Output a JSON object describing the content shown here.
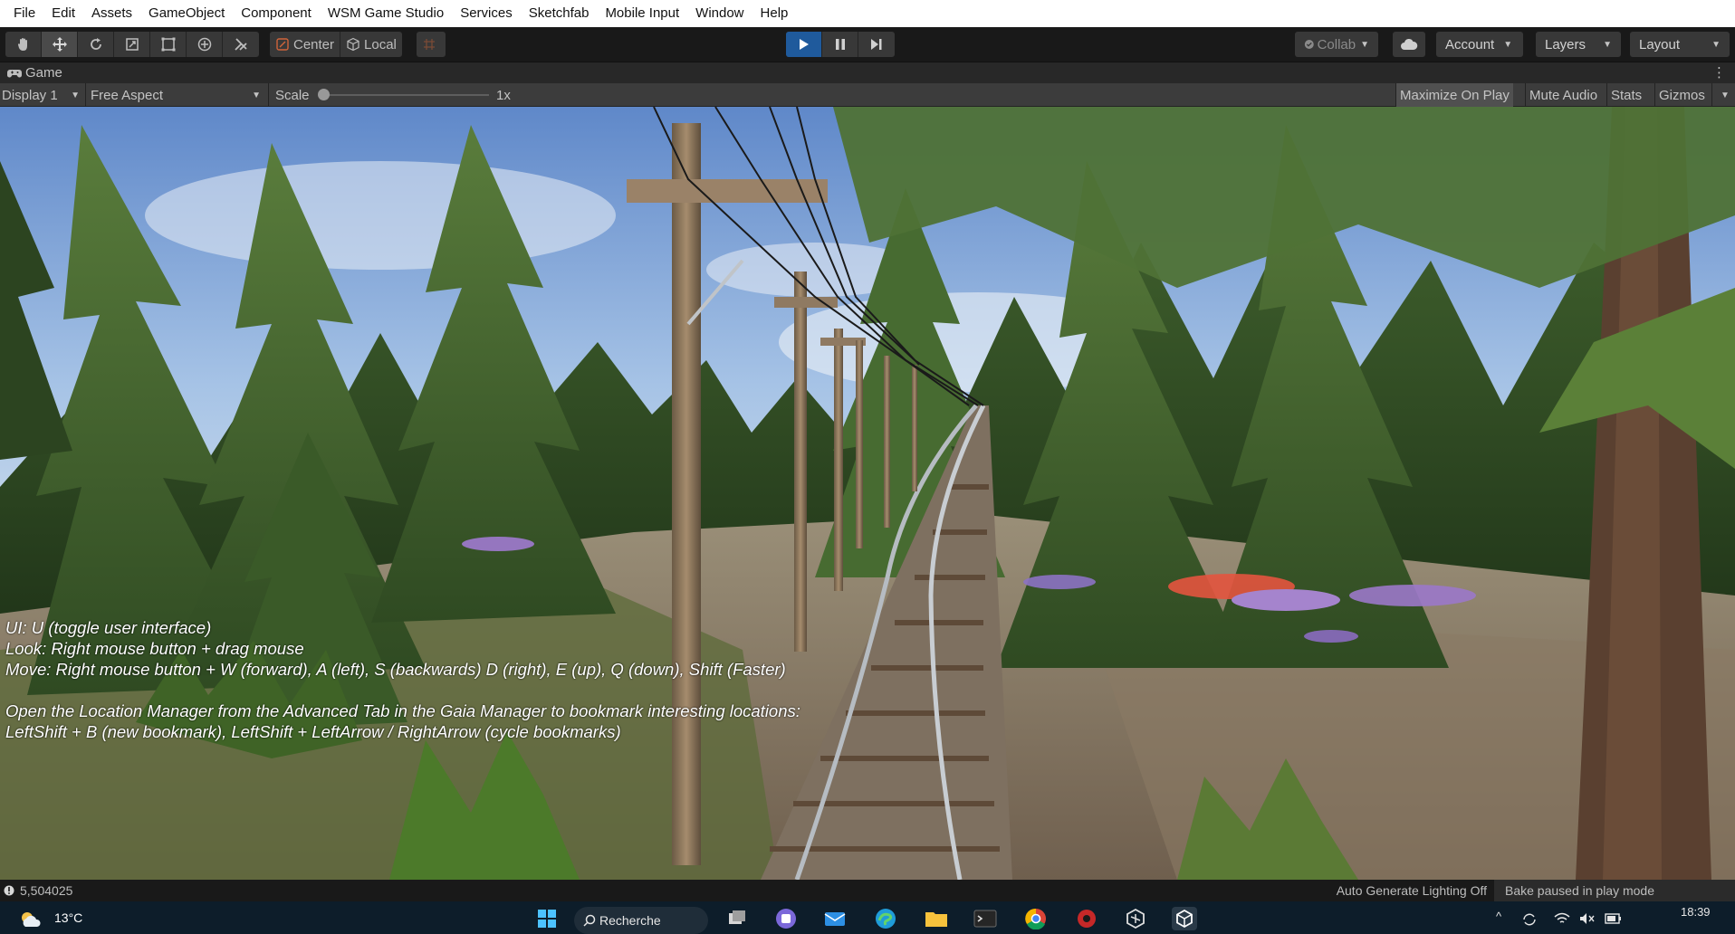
{
  "menu": [
    "File",
    "Edit",
    "Assets",
    "GameObject",
    "Component",
    "WSM Game Studio",
    "Services",
    "Sketchfab",
    "Mobile Input",
    "Window",
    "Help"
  ],
  "toolbar": {
    "tools": [
      "hand-tool",
      "move-tool",
      "rotate-tool",
      "scale-tool",
      "rect-tool",
      "transform-tool",
      "custom-tool"
    ],
    "pivot_label": "Center",
    "space_label": "Local",
    "collab_label": "Collab",
    "account_label": "Account",
    "layers_label": "Layers",
    "layout_label": "Layout"
  },
  "game_tab": {
    "label": "Game"
  },
  "game_toolbar": {
    "display": "Display 1",
    "aspect": "Free Aspect",
    "scale_label": "Scale",
    "scale_value": "1x",
    "maximize": "Maximize On Play",
    "mute": "Mute Audio",
    "stats": "Stats",
    "gizmos": "Gizmos"
  },
  "overlay": {
    "line1": "UI: U (toggle user interface)",
    "line2": "Look: Right mouse button + drag mouse",
    "line3": "Move: Right mouse button + W (forward), A (left), S (backwards) D (right), E (up), Q (down), Shift (Faster)",
    "line4": "Open the Location Manager from the Advanced Tab in the Gaia Manager to bookmark interesting locations:",
    "line5": "LeftShift + B (new bookmark), LeftShift + LeftArrow / RightArrow (cycle bookmarks)"
  },
  "status": {
    "console_value": "5,504025",
    "lighting": "Auto Generate Lighting Off",
    "bake": "Bake paused in play mode"
  },
  "taskbar": {
    "temperature": "13°C",
    "search_label": "Recherche",
    "time": "18:39"
  }
}
